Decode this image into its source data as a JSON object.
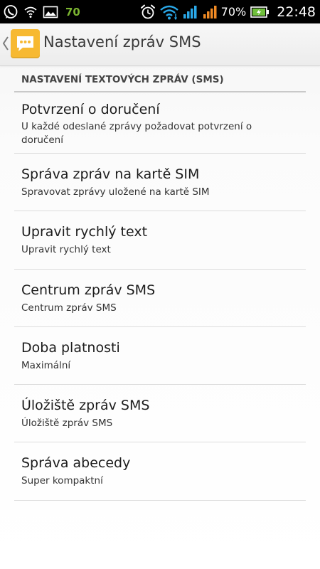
{
  "status_bar": {
    "icons_left": [
      "whatsapp-icon",
      "wifi-icon",
      "gallery-icon"
    ],
    "badge_value": "70",
    "icons_right": [
      "alarm-icon",
      "wifi-icon",
      "signal-icon",
      "signal-icon",
      "battery-charging-icon"
    ],
    "battery_percent": "70%",
    "time": "22:48",
    "colors": {
      "background": "#000000",
      "wifi": "#2aa8e8",
      "signal_sim1": "#2aa8e8",
      "signal_sim2": "#f08a24",
      "battery": "#6fbf3b",
      "badge": "#7bb431"
    }
  },
  "action_bar": {
    "title": "Nastavení zpráv SMS",
    "back_icon": "chevron-left-icon",
    "app_icon": "messaging-app-icon",
    "app_icon_color": "#f7b931"
  },
  "section": {
    "header": "NASTAVENÍ TEXTOVÝCH ZPRÁV (SMS)"
  },
  "preferences": [
    {
      "title": "Potvrzení o doručení",
      "summary": "U každé odeslané zprávy požadovat potvrzení o doručení"
    },
    {
      "title": "Správa zpráv na kartě SIM",
      "summary": "Spravovat zprávy uložené na kartě SIM"
    },
    {
      "title": "Upravit rychlý text",
      "summary": "Upravit rychlý text"
    },
    {
      "title": "Centrum zpráv SMS",
      "summary": "Centrum zpráv SMS"
    },
    {
      "title": "Doba platnosti",
      "summary": "Maximální"
    },
    {
      "title": "Úložiště zpráv SMS",
      "summary": "Úložiště zpráv SMS"
    },
    {
      "title": "Správa abecedy",
      "summary": "Super kompaktní"
    }
  ]
}
